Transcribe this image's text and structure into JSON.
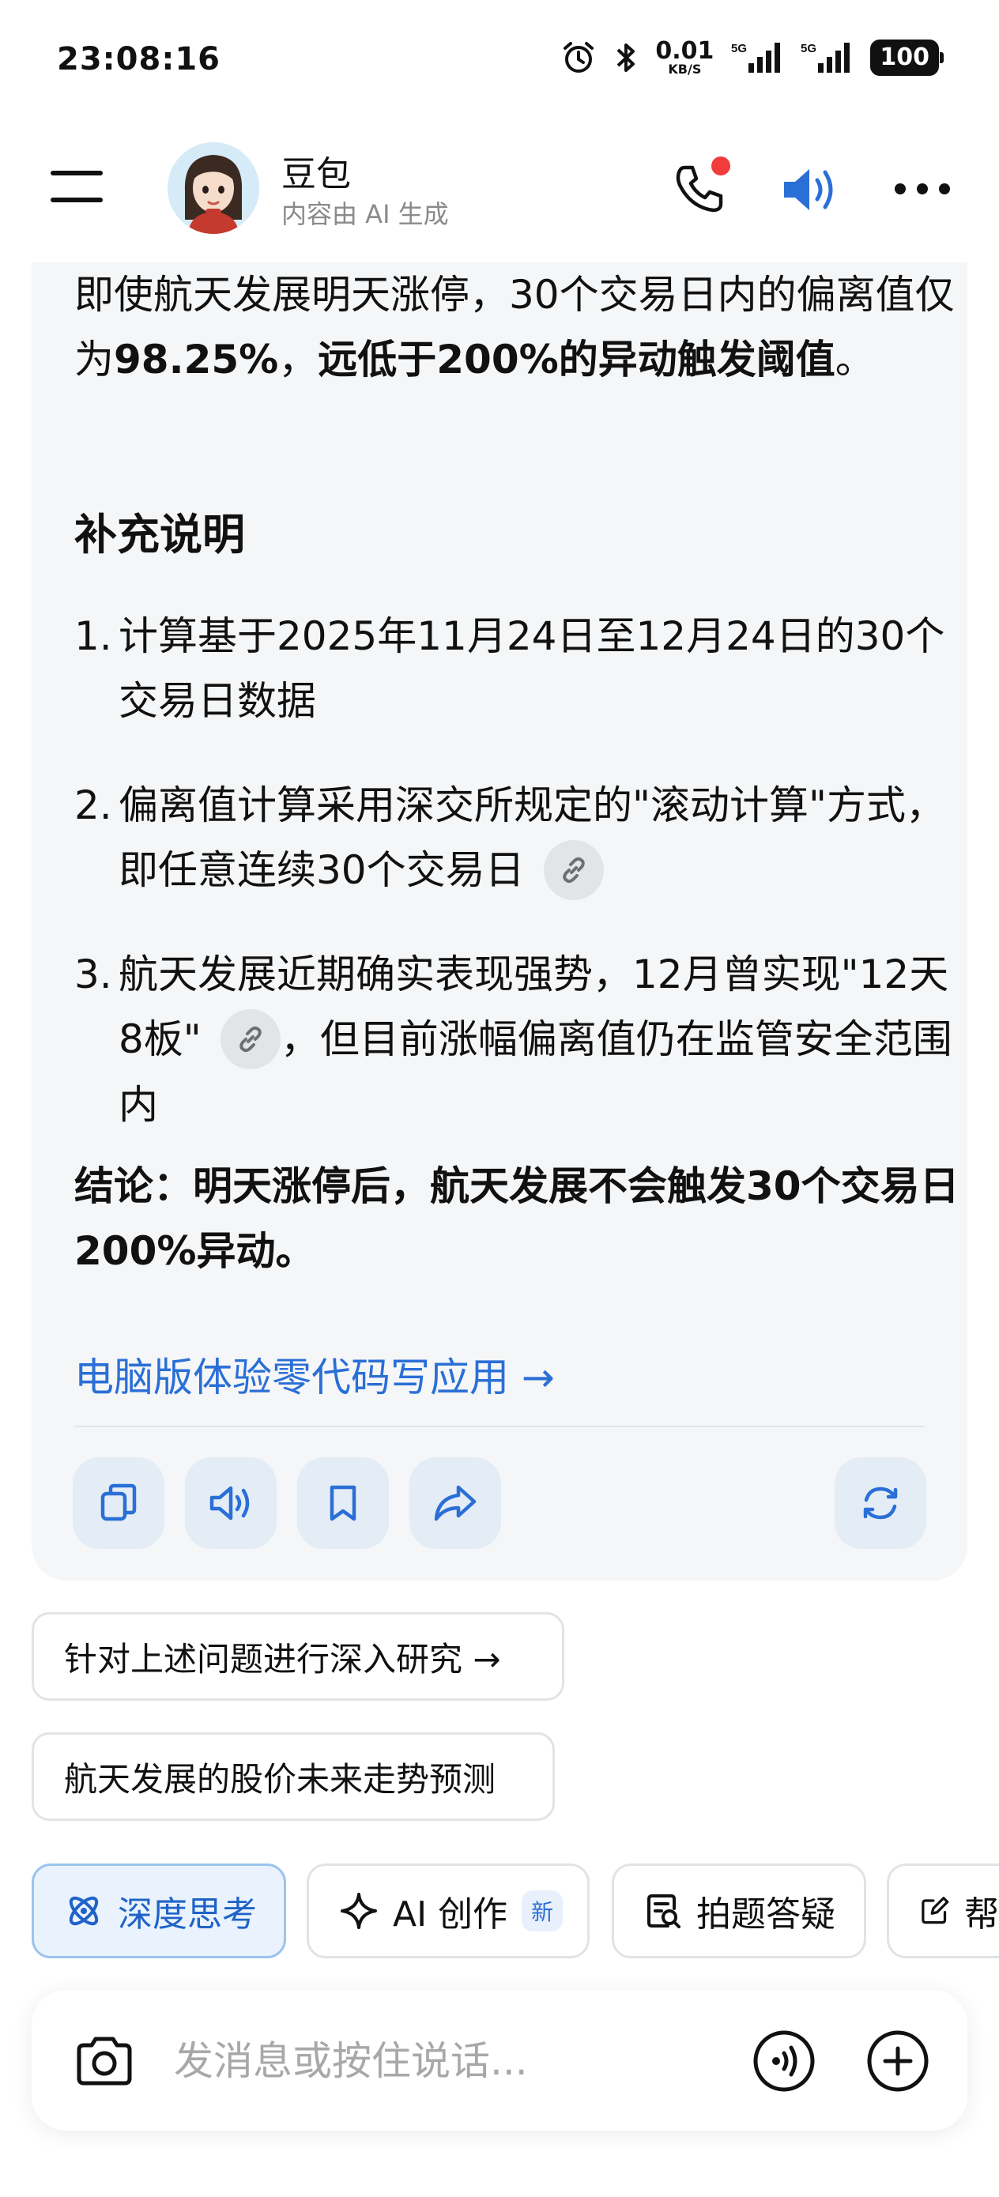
{
  "status_bar": {
    "time": "23:08:16",
    "net_speed_value": "0.01",
    "net_speed_unit": "KB/S",
    "signal_1_label": "5G",
    "signal_2_label": "5G",
    "battery": "100",
    "icons": [
      "alarm-icon",
      "bluetooth-icon",
      "signal-icon",
      "signal-icon",
      "battery-icon"
    ]
  },
  "header": {
    "bot_name": "豆包",
    "subtitle": "内容由 AI 生成",
    "icons": [
      "menu-icon",
      "phone-icon",
      "speaker-icon",
      "more-icon"
    ],
    "accent_color": "#2a6fd6",
    "notification_dot_color": "#f23b3b"
  },
  "message": {
    "p1_a": "即使航天发展明天涨停，30个交易日内的偏离值仅为",
    "p1_b": "98.25%",
    "p1_c": "，",
    "p1_d": "远低于200%的异动触发阈值",
    "p1_e": "。",
    "section_title": "补充说明",
    "items": [
      {
        "num": "1.",
        "text": "计算基于2025年11月24日至12月24日的30个交易日数据"
      },
      {
        "num": "2.",
        "text": "偏离值计算采用深交所规定的\"滚动计算\"方式，即任意连续30个交易日"
      },
      {
        "num": "3.",
        "text_a": "航天发展近期确实表现强势，12月曾实现\"12天8板\"",
        "text_b": "，但目前涨幅偏离值仍在监管安全范围内"
      }
    ],
    "conclusion": "结论：明天涨停后，航天发展不会触发30个交易日200%异动。",
    "promo_link": "电脑版体验零代码写应用 →",
    "actions": [
      "copy-icon",
      "read-aloud-icon",
      "bookmark-icon",
      "share-icon",
      "regenerate-icon"
    ]
  },
  "suggestions": [
    "针对上述问题进行深入研究 →",
    "航天发展的股价未来走势预测"
  ],
  "tools": [
    {
      "label": "深度思考",
      "icon": "atom-icon",
      "active": true
    },
    {
      "label": "AI 创作",
      "icon": "sparkle-icon",
      "badge": "新"
    },
    {
      "label": "拍题答疑",
      "icon": "photo-search-icon"
    },
    {
      "label": "帮",
      "icon": "edit-icon"
    }
  ],
  "input": {
    "placeholder": "发消息或按住说话...",
    "icons": [
      "camera-icon",
      "voice-call-icon",
      "plus-icon"
    ]
  }
}
